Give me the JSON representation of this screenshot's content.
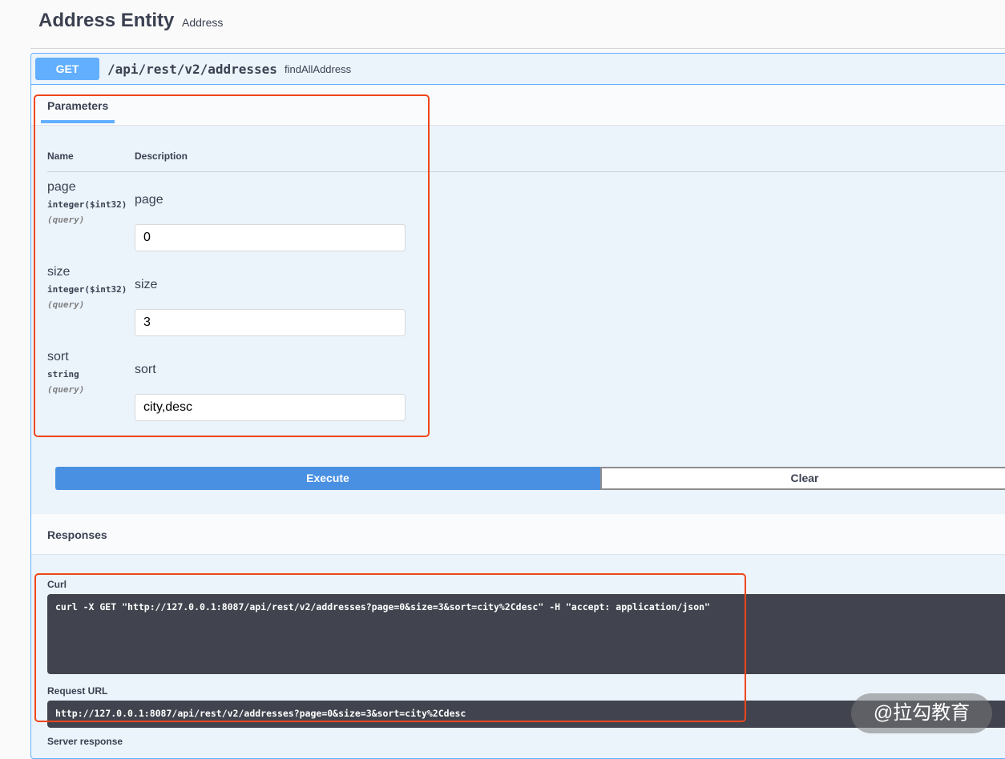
{
  "tag": {
    "title": "Address Entity",
    "description": "Address"
  },
  "operation": {
    "method": "GET",
    "path": "/api/rest/v2/addresses",
    "operation_id": "findAllAddress"
  },
  "parameters_section": {
    "tab_label": "Parameters",
    "col_name": "Name",
    "col_description": "Description",
    "params": [
      {
        "name": "page",
        "type": "integer($int32)",
        "in": "(query)",
        "description": "page",
        "value": "0"
      },
      {
        "name": "size",
        "type": "integer($int32)",
        "in": "(query)",
        "description": "size",
        "value": "3"
      },
      {
        "name": "sort",
        "type": "string",
        "in": "(query)",
        "description": "sort",
        "value": "city,desc"
      }
    ]
  },
  "actions": {
    "execute_label": "Execute",
    "clear_label": "Clear"
  },
  "responses": {
    "title": "Responses",
    "curl_label": "Curl",
    "curl_command": "curl -X GET \"http://127.0.0.1:8087/api/rest/v2/addresses?page=0&size=3&sort=city%2Cdesc\" -H \"accept: application/json\"",
    "request_url_label": "Request URL",
    "request_url": "http://127.0.0.1:8087/api/rest/v2/addresses?page=0&size=3&sort=city%2Cdesc",
    "server_response_label": "Server response"
  },
  "watermark": "@拉勾教育",
  "colors": {
    "get_accent": "#61affe",
    "execute": "#4990e2",
    "highlight": "#f0461a",
    "code_bg": "#41444e"
  }
}
